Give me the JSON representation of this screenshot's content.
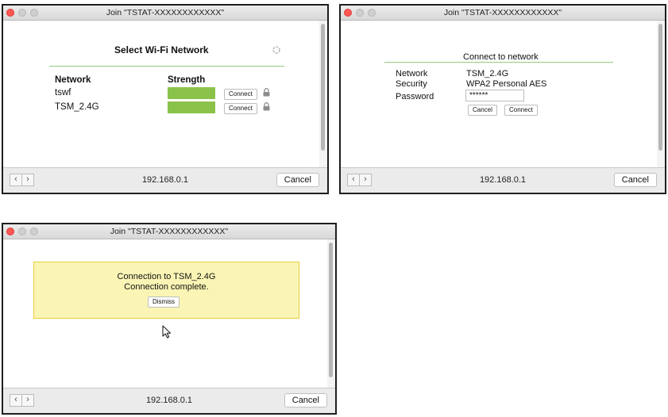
{
  "window_title": "Join \"TSTAT-XXXXXXXXXXXX\"",
  "address": "192.168.0.1",
  "bottom_cancel_label": "Cancel",
  "nav": {
    "back_glyph": "‹",
    "forward_glyph": "›"
  },
  "colors": {
    "strength_green": "#8bc34a",
    "divider_green": "#8fcf7f",
    "success_bg": "#fbf5b5",
    "success_border": "#e7cf3c"
  },
  "icons": [
    "spinner-icon",
    "lock-icon",
    "back-arrow-icon",
    "forward-arrow-icon",
    "cursor-icon"
  ],
  "select_screen": {
    "heading": "Select Wi-Fi Network",
    "col_network": "Network",
    "col_strength": "Strength",
    "networks": [
      {
        "name": "tswf",
        "connect_label": "Connect"
      },
      {
        "name": "TSM_2.4G",
        "connect_label": "Connect"
      }
    ]
  },
  "connect_screen": {
    "heading": "Connect to network",
    "network_label": "Network",
    "network_value": "TSM_2.4G",
    "security_label": "Security",
    "security_value": "WPA2 Personal AES",
    "password_label": "Password",
    "password_value": "******",
    "cancel_label": "Cancel",
    "connect_label": "Connect"
  },
  "success_screen": {
    "line1": "Connection to TSM_2.4G",
    "line2": "Connection complete.",
    "dismiss_label": "Dismiss"
  }
}
